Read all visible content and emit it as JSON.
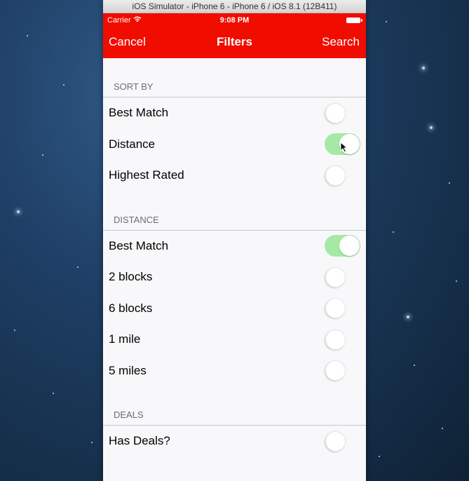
{
  "window_title": "iOS Simulator - iPhone 6 - iPhone 6 / iOS 8.1 (12B411)",
  "status_bar": {
    "carrier": "Carrier",
    "time": "9:08 PM"
  },
  "nav": {
    "cancel_label": "Cancel",
    "title": "Filters",
    "search_label": "Search",
    "bar_color": "#f00d00"
  },
  "sections": [
    {
      "header": "SORT BY",
      "rows": [
        {
          "label": "Best Match",
          "on": false
        },
        {
          "label": "Distance",
          "on": true
        },
        {
          "label": "Highest Rated",
          "on": false
        }
      ]
    },
    {
      "header": "DISTANCE",
      "rows": [
        {
          "label": "Best Match",
          "on": true
        },
        {
          "label": "2 blocks",
          "on": false
        },
        {
          "label": "6 blocks",
          "on": false
        },
        {
          "label": "1 mile",
          "on": false
        },
        {
          "label": "5 miles",
          "on": false
        }
      ]
    },
    {
      "header": "DEALS",
      "rows": [
        {
          "label": "Has Deals?",
          "on": false
        }
      ]
    }
  ],
  "icons": {
    "wifi": "wifi-icon",
    "battery": "battery-icon",
    "cursor": "mouse-cursor-icon"
  },
  "colors": {
    "toggle_on": "#a6e9a6",
    "background": "#f8f8fa"
  }
}
